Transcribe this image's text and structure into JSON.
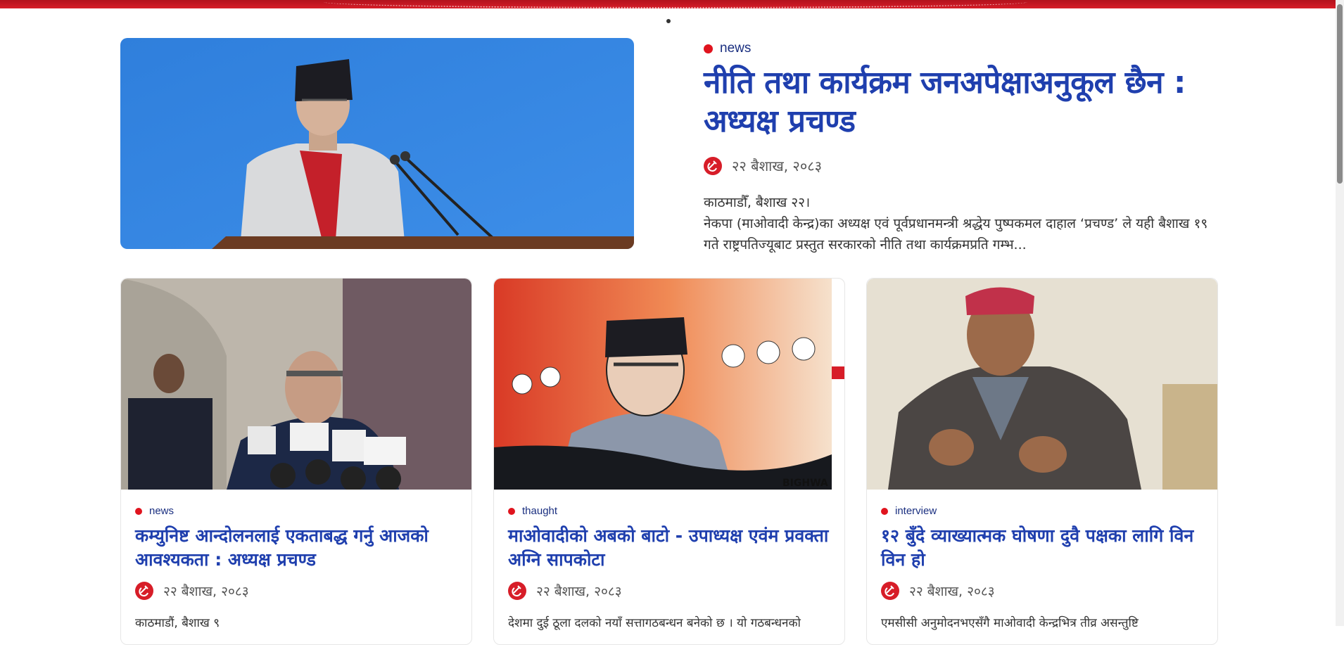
{
  "featured": {
    "category": "news",
    "title": "नीति तथा कार्यक्रम जनअपेक्षाअनुकूल छैन : अध्यक्ष प्रचण्ड",
    "date": "२२ बैशाख, २०८३",
    "excerpt_line1": "काठमाडौँ, बैशाख २२।",
    "excerpt_line2": "नेकपा (माओवादी केन्द्र)का अध्यक्ष एवं पूर्वप्रधानमन्त्री श्रद्धेय पुष्पकमल दाहाल ‘प्रचण्ड’ ले यही बैशाख १९ गते राष्ट्रपतिज्यूबाट प्रस्तुत सरकारको नीति तथा कार्यक्रमप्रति गम्भ..."
  },
  "cards": [
    {
      "category": "news",
      "title": "कम्युनिष्ट आन्दोलनलाई एकताबद्ध गर्नु आजको आवश्यकता : अध्यक्ष प्रचण्ड",
      "date": "२२ बैशाख, २०८३",
      "excerpt": "काठमाडौं, बैशाख ९"
    },
    {
      "category": "thaught",
      "title": "माओवादीको अबको बाटो - उपाध्यक्ष एवंम प्रवक्ता अग्नि सापकोटा",
      "date": "२२ बैशाख, २०८३",
      "excerpt": "देशमा दुई ठूला दलको नयाँ सत्तागठबन्धन बनेको छ । यो गठबन्धनको"
    },
    {
      "category": "interview",
      "title": "१२ बुँदे व्याख्यात्मक घोषणा दुवै पक्षका लागि विन विन हो",
      "date": "२२ बैशाख, २०८३",
      "excerpt": "एमसीसी अनुमोदनभएसँगै माओवादी केन्द्रभित्र तीव्र असन्तुष्टि"
    }
  ],
  "cartoon_signature": "BIGHWA",
  "colors": {
    "accent_red": "#e0141e",
    "title_blue": "#1f3fae",
    "category_blue": "#1a2f80"
  },
  "icons": {
    "category_bullet": "red-dot-icon",
    "author_logo": "hammer-sickle-icon"
  }
}
